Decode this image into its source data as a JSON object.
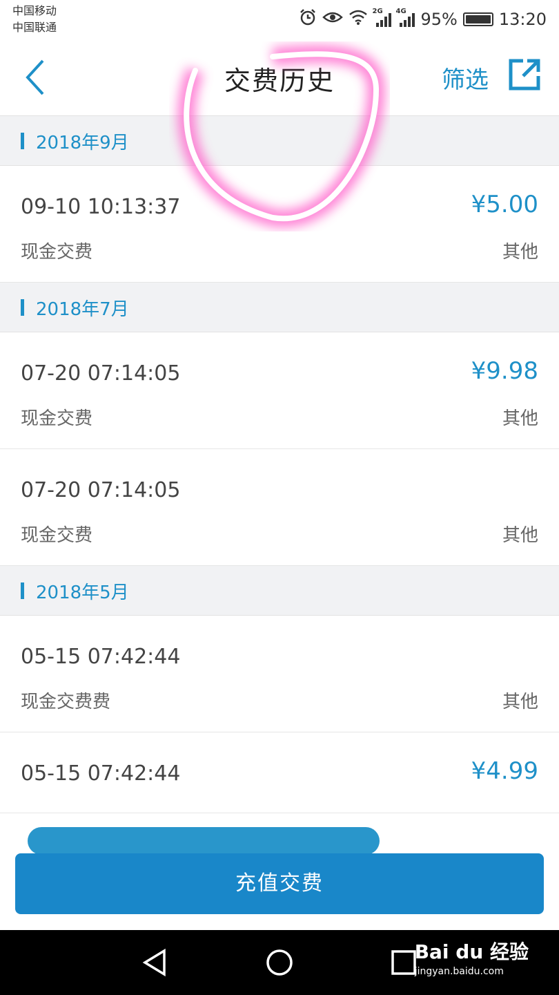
{
  "status_bar": {
    "carrier_1": "中国移动",
    "carrier_2": "中国联通",
    "net_1": "2G",
    "net_2": "4G",
    "battery": "95%",
    "time": "13:20"
  },
  "header": {
    "title": "交费历史",
    "filter_label": "筛选"
  },
  "groups": [
    {
      "month": "2018年9月",
      "items": [
        {
          "time": "09-10 10:13:37",
          "amount": "¥5.00",
          "type": "现金交费",
          "category": "其他"
        }
      ]
    },
    {
      "month": "2018年7月",
      "items": [
        {
          "time": "07-20 07:14:05",
          "amount": "¥9.98",
          "type": "现金交费",
          "category": "其他"
        },
        {
          "time": "07-20 07:14:05",
          "amount": "",
          "type": "现金交费",
          "category": "其他"
        }
      ]
    },
    {
      "month": "2018年5月",
      "items": [
        {
          "time": "05-15 07:42:44",
          "amount": "",
          "type": "现金交费费",
          "category": "其他"
        },
        {
          "time": "05-15 07:42:44",
          "amount": "¥4.99",
          "type": "",
          "category": ""
        }
      ]
    }
  ],
  "bottom": {
    "recharge_label": "充值交费"
  },
  "watermark": {
    "brand": "Bai du 经验",
    "url": "jingyan.baidu.com"
  },
  "colors": {
    "accent": "#1e90c8",
    "button": "#1987c9",
    "highlight": "#ff66cc"
  }
}
